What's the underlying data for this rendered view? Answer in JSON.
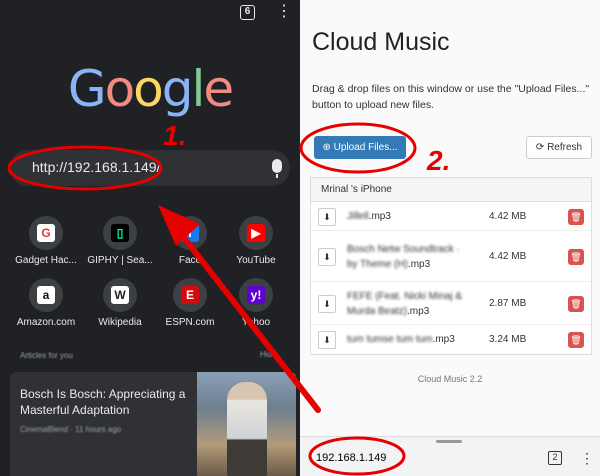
{
  "left": {
    "tab_count": "6",
    "logo_letters": [
      {
        "ch": "G",
        "color": "#8ab4f8"
      },
      {
        "ch": "o",
        "color": "#f28b82"
      },
      {
        "ch": "o",
        "color": "#fdd663"
      },
      {
        "ch": "g",
        "color": "#8ab4f8"
      },
      {
        "ch": "l",
        "color": "#81c995"
      },
      {
        "ch": "e",
        "color": "#f28b82"
      }
    ],
    "url_text": "http://192.168.1.149/",
    "shortcuts": [
      {
        "label": "Gadget Hac...",
        "glyph": "G",
        "bg": "#ffffff",
        "fg": "#e53935",
        "icon": "gadget-hacks-icon"
      },
      {
        "label": "GIPHY | Sea...",
        "glyph": "▯",
        "bg": "#000000",
        "fg": "#00ff99",
        "icon": "giphy-icon"
      },
      {
        "label": "Face",
        "glyph": "f",
        "bg": "#1877f2",
        "fg": "#ffffff",
        "icon": "facebook-icon"
      },
      {
        "label": "YouTube",
        "glyph": "▶",
        "bg": "#ff0000",
        "fg": "#ffffff",
        "icon": "youtube-icon"
      },
      {
        "label": "Amazon.com",
        "glyph": "a",
        "bg": "#ffffff",
        "fg": "#111111",
        "icon": "amazon-icon"
      },
      {
        "label": "Wikipedia",
        "glyph": "W",
        "bg": "#ffffff",
        "fg": "#222222",
        "icon": "wikipedia-icon"
      },
      {
        "label": "ESPN.com",
        "glyph": "E",
        "bg": "#d50a0a",
        "fg": "#ffffff",
        "icon": "espn-icon"
      },
      {
        "label": "Yahoo",
        "glyph": "y!",
        "bg": "#5f01d1",
        "fg": "#ffffff",
        "icon": "yahoo-icon"
      }
    ],
    "articles_heading": "Articles for you",
    "articles_more": "Hide",
    "article": {
      "title": "Bosch Is Bosch: Appreciating a Masterful Adaptation",
      "meta": "CinemaBlend · 11 hours ago"
    }
  },
  "right": {
    "title": "Cloud Music",
    "description": "Drag & drop files on this window or use the \"Upload Files...\" button to upload new files.",
    "upload_label": "Upload Files...",
    "refresh_label": "Refresh",
    "device_name": "Mrinal 's iPhone",
    "files": [
      {
        "name_blur": "Jillell",
        "name_ext": ".mp3",
        "size": "4.42 MB"
      },
      {
        "name_blur": "Bosch Netw Soundtrack · by Theme (H)",
        "name_ext": ".mp3",
        "size": "4.42 MB"
      },
      {
        "name_blur": "FEFE (Feat. Nicki Minaj & Murda Beatz)",
        "name_ext": ".mp3",
        "size": "2.87 MB"
      },
      {
        "name_blur": "tum tumse tum tum",
        "name_ext": ".mp3",
        "size": "3.24 MB"
      }
    ],
    "footer": "Cloud Music 2.2",
    "bottom_url": "192.168.1.149",
    "bottom_tab_count": "2"
  },
  "annotations": {
    "step1": "1.",
    "step2": "2.",
    "color": "#e60000"
  }
}
